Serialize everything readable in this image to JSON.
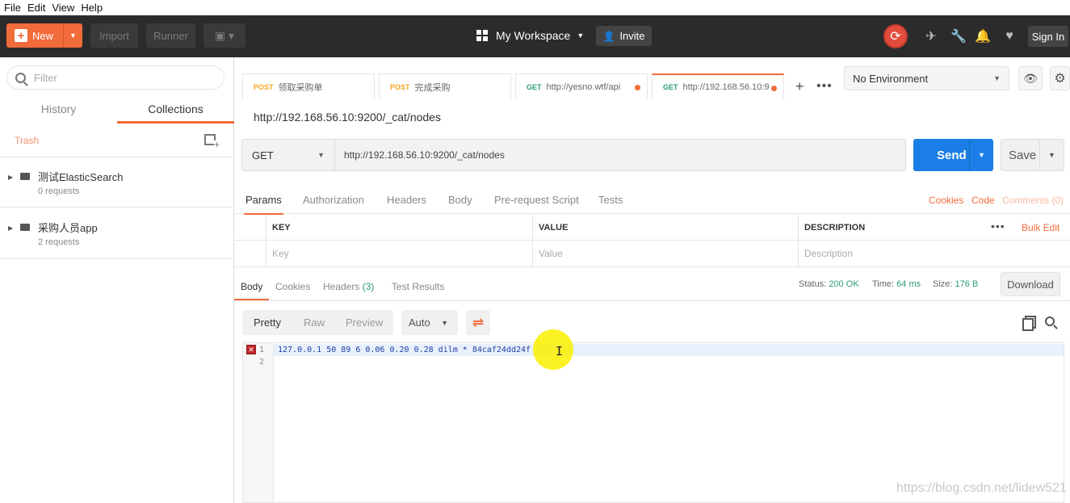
{
  "menu": [
    "File",
    "Edit",
    "View",
    "Help"
  ],
  "header": {
    "new_label": "New",
    "import_label": "Import",
    "runner_label": "Runner",
    "workspace_label": "My Workspace",
    "invite_label": "Invite",
    "signin_label": "Sign In",
    "accent": "#f26b3a"
  },
  "sidebar": {
    "filter_placeholder": "Filter",
    "tabs": [
      "History",
      "Collections"
    ],
    "trash_label": "Trash",
    "collections": [
      {
        "name": "测试ElasticSearch",
        "count": "0 requests"
      },
      {
        "name": "采购人员app",
        "count": "2 requests"
      }
    ]
  },
  "tabs": [
    {
      "method": "POST",
      "label": "领取采购单"
    },
    {
      "method": "POST",
      "label": "完成采购"
    },
    {
      "method": "GET",
      "label": "http://yesno.wtf/api"
    },
    {
      "method": "GET",
      "label": "http://192.168.56.10:9"
    }
  ],
  "environment": {
    "selected": "No Environment"
  },
  "request": {
    "title": "http://192.168.56.10:9200/_cat/nodes",
    "method": "GET",
    "url": "http://192.168.56.10:9200/_cat/nodes",
    "send_label": "Send",
    "save_label": "Save"
  },
  "param_tabs": [
    "Params",
    "Authorization",
    "Headers",
    "Body",
    "Pre-request Script",
    "Tests"
  ],
  "param_links": {
    "cookies": "Cookies",
    "code": "Code",
    "comments": "Comments (0)"
  },
  "params_table": {
    "headers": [
      "KEY",
      "VALUE",
      "DESCRIPTION"
    ],
    "placeholders": [
      "Key",
      "Value",
      "Description"
    ],
    "bulk_edit": "Bulk Edit"
  },
  "response": {
    "tabs": {
      "body": "Body",
      "cookies": "Cookies",
      "headers": "Headers",
      "headers_count": "(3)",
      "tests": "Test Results"
    },
    "status_label": "Status:",
    "status_value": "200 OK",
    "time_label": "Time:",
    "time_value": "64 ms",
    "size_label": "Size:",
    "size_value": "176 B",
    "download_label": "Download",
    "views": [
      "Pretty",
      "Raw",
      "Preview"
    ],
    "format": "Auto",
    "lines": [
      "1",
      "2"
    ],
    "code": "127.0.0.1 50 89 6 0.06 0.20 0.28 dilm * 84caf24dd24f "
  },
  "watermark": "https://blog.csdn.net/lidew521"
}
